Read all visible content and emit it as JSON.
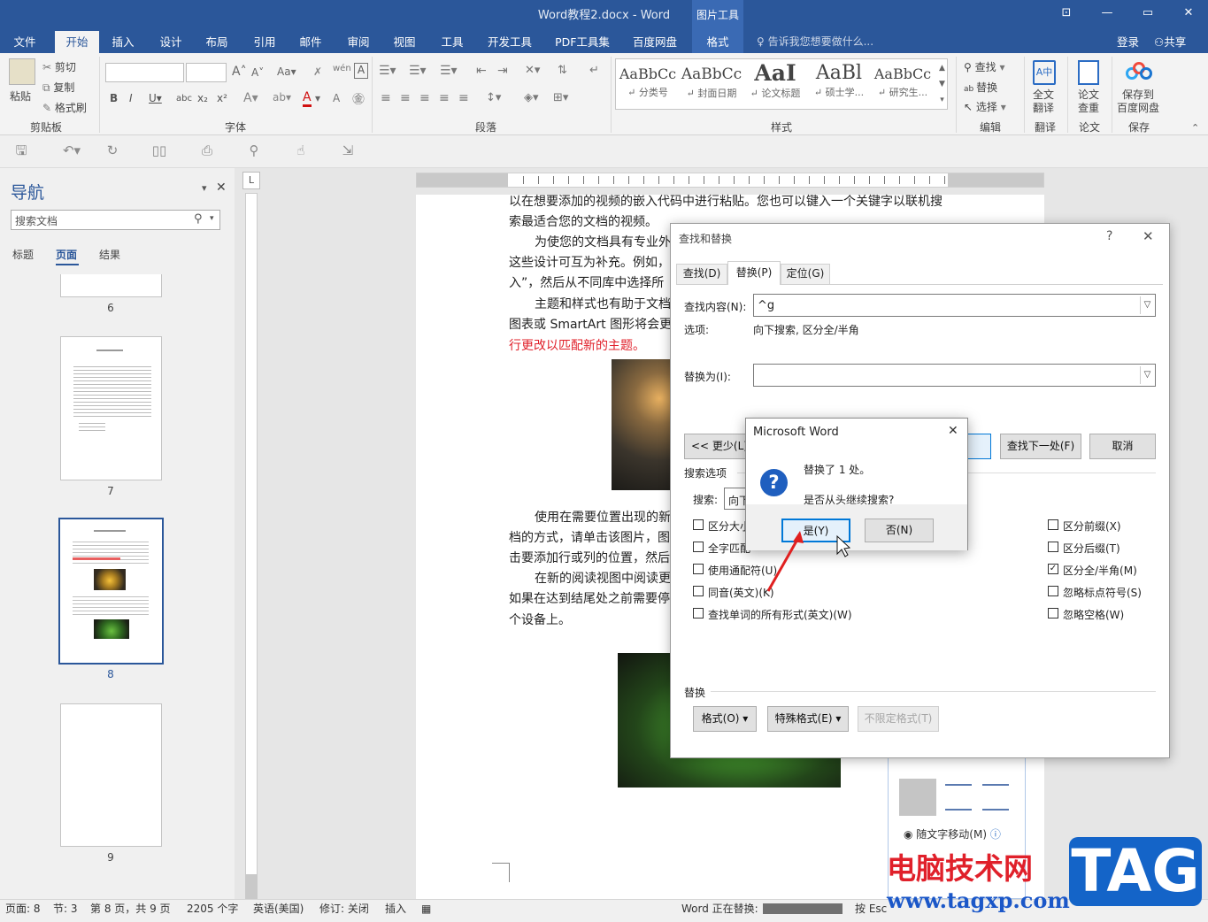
{
  "window": {
    "title": "Word教程2.docx - Word",
    "context_group": "图片工具",
    "min": "—",
    "restore": "▭",
    "close": "✕",
    "ribbon_opt": "⊡"
  },
  "tabs": [
    "文件",
    "开始",
    "插入",
    "设计",
    "布局",
    "引用",
    "邮件",
    "审阅",
    "视图",
    "工具",
    "开发工具",
    "PDF工具集",
    "百度网盘",
    "格式"
  ],
  "tell_me": "告诉我您想要做什么...",
  "account": {
    "signin": "登录",
    "share": "共享"
  },
  "ribbon": {
    "clipboard": {
      "paste": "粘贴",
      "cut": "剪切",
      "copy": "复制",
      "format_painter": "格式刷",
      "label": "剪贴板"
    },
    "font": {
      "label": "字体",
      "font_name": "",
      "font_size": ""
    },
    "paragraph": {
      "label": "段落"
    },
    "styles": {
      "label": "样式",
      "items": [
        {
          "sample": "AaBbCc",
          "name": "↵ 分类号"
        },
        {
          "sample": "AaBbCc",
          "name": "↵ 封面日期"
        },
        {
          "sample": "AaI",
          "name": "↵ 论文标题"
        },
        {
          "sample": "AaBl",
          "name": "↵ 硕士学..."
        },
        {
          "sample": "AaBbCc",
          "name": "↵ 研究生..."
        }
      ]
    },
    "editing": {
      "find": "查找",
      "replace": "替换",
      "select": "选择",
      "label": "编辑"
    },
    "translate": {
      "btn1": "全文",
      "btn2": "翻译",
      "label": "翻译"
    },
    "paper": {
      "btn1": "论文",
      "btn2": "查重",
      "label": "论文"
    },
    "save": {
      "btn1": "保存到",
      "btn2": "百度网盘",
      "label": "保存"
    }
  },
  "nav": {
    "title": "导航",
    "search_placeholder": "搜索文档",
    "tabs": [
      "标题",
      "页面",
      "结果"
    ],
    "pages": [
      "6",
      "7",
      "8",
      "9"
    ]
  },
  "document": {
    "lines": [
      "以在想要添加的视频的嵌入代码中进行粘贴。您也可以键入一个关键字以联机搜",
      "索最适合您的文档的视频。",
      "为使您的文档具有专业外",
      "这些设计可互为补充。例如，",
      "入”，然后从不同库中选择所",
      "主题和样式也有助于文档",
      "图表或 SmartArt 图形将会更",
      "行更改以匹配新的主题。",
      "使用在需要位置出现的新",
      "档的方式，请单击该图片，图",
      "击要添加行或列的位置，然后",
      "在新的阅读视图中阅读更",
      "如果在达到结尾处之前需要停",
      "个设备上。"
    ],
    "layout_option": "随文字移动(M)"
  },
  "find_replace": {
    "title": "查找和替换",
    "help": "?",
    "close": "✕",
    "tabs": [
      "查找(D)",
      "替换(P)",
      "定位(G)"
    ],
    "find_label": "查找内容(N):",
    "find_value": "^g",
    "options_label": "选项:",
    "options_value": "向下搜索, 区分全/半角",
    "replace_label": "替换为(I):",
    "replace_value": "",
    "less_btn": "<< 更少(L)",
    "find_next_btn": "查找下一处(F)",
    "cancel_btn": "取消",
    "search_options_label": "搜索选项",
    "search_label": "搜索:",
    "search_value": "向下",
    "left_checks": [
      {
        "label": "区分大小",
        "checked": false
      },
      {
        "label": "全字匹配",
        "checked": false
      },
      {
        "label": "使用通配符(U)",
        "checked": false
      },
      {
        "label": "同音(英文)(K)",
        "checked": false
      },
      {
        "label": "查找单词的所有形式(英文)(W)",
        "checked": false
      }
    ],
    "right_checks": [
      {
        "label": "区分前缀(X)",
        "checked": false
      },
      {
        "label": "区分后缀(T)",
        "checked": false
      },
      {
        "label": "区分全/半角(M)",
        "checked": true
      },
      {
        "label": "忽略标点符号(S)",
        "checked": false
      },
      {
        "label": "忽略空格(W)",
        "checked": false
      }
    ],
    "replace_section_label": "替换",
    "format_btn": "格式(O) ▾",
    "special_btn": "特殊格式(E) ▾",
    "no_format_btn": "不限定格式(T)"
  },
  "msgbox": {
    "title": "Microsoft Word",
    "close": "✕",
    "line1": "替换了 1 处。",
    "line2": "是否从头继续搜索?",
    "yes": "是(Y)",
    "no": "否(N)"
  },
  "status": {
    "page": "页面: 8",
    "section": "节: 3",
    "pages": "第 8 页，共 9 页",
    "words": "2205 个字",
    "language": "英语(美国)",
    "track": "修订: 关闭",
    "insert": "插入",
    "replacing": "Word 正在替换:",
    "esc": "按 Esc"
  },
  "watermark": {
    "cn": "电脑技术网",
    "url": "www.tagxp.com",
    "tag": "TAG"
  },
  "colors": {
    "accent": "#2b579a",
    "red_text": "#e0202a",
    "msg_icon": "#1f5fbf"
  }
}
